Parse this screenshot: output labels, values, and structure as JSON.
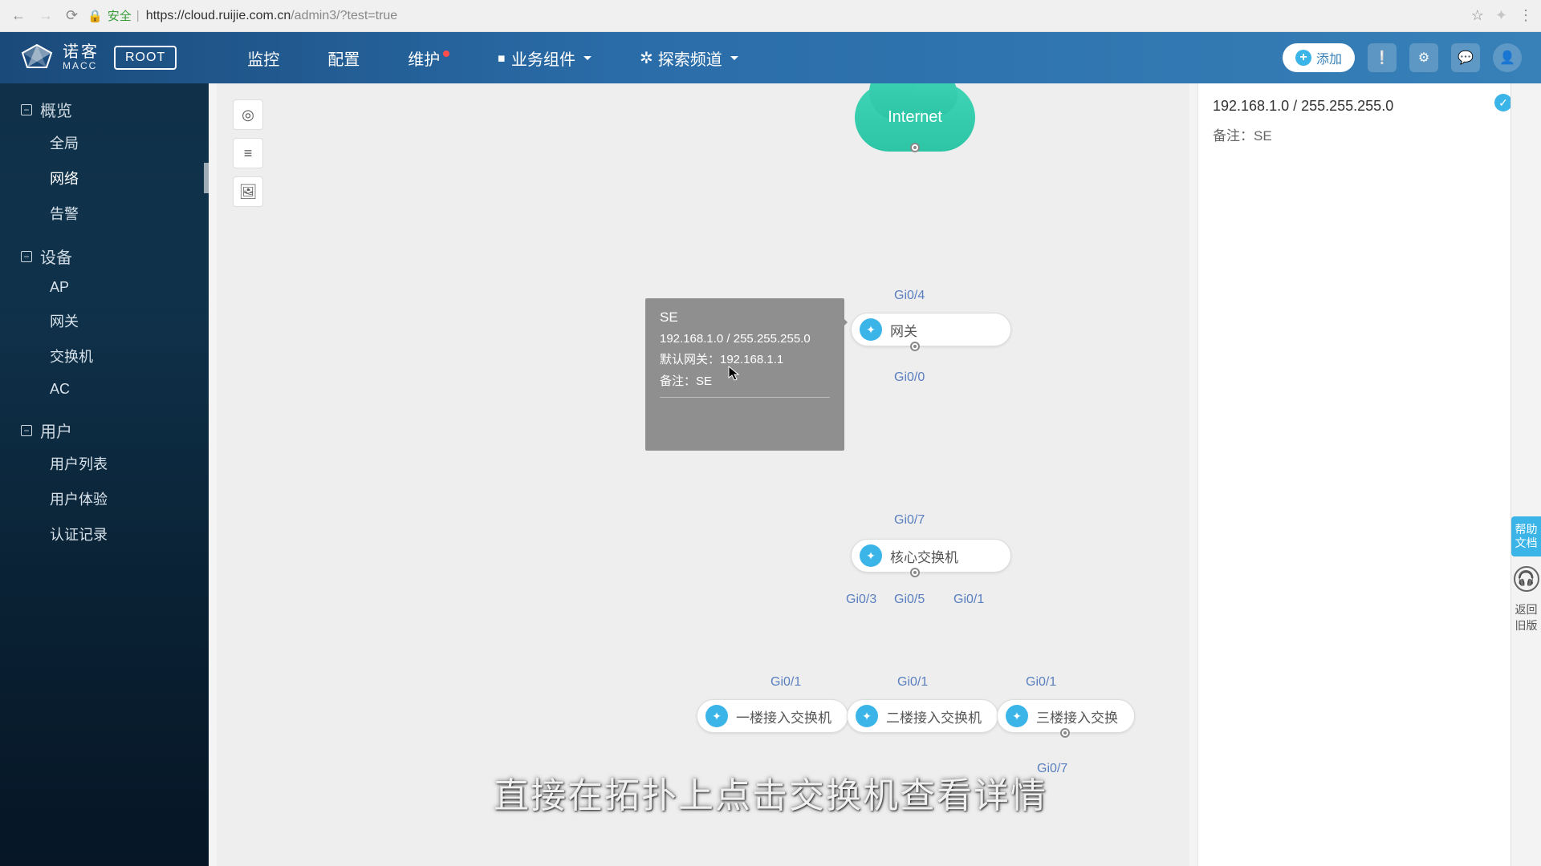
{
  "browser": {
    "secure_label": "安全",
    "url_host": "https://cloud.ruijie.com.cn",
    "url_path": "/admin3/?test=true"
  },
  "brand": {
    "cn": "诺客",
    "en": "MACC",
    "root": "ROOT"
  },
  "topnav": {
    "items": [
      "监控",
      "配置",
      "维护",
      "业务组件",
      "探索频道"
    ],
    "add": "添加"
  },
  "sidebar": {
    "groups": [
      {
        "title": "概览",
        "items": [
          "全局",
          "网络",
          "告警"
        ],
        "active": 1
      },
      {
        "title": "设备",
        "items": [
          "AP",
          "网关",
          "交换机",
          "AC"
        ]
      },
      {
        "title": "用户",
        "items": [
          "用户列表",
          "用户体验",
          "认证记录"
        ]
      }
    ]
  },
  "right_panel": {
    "ip": "192.168.1.0 / 255.255.255.0",
    "note": "备注：SE"
  },
  "topology": {
    "internet": "Internet",
    "nodes": {
      "gateway": "网关",
      "core": "核心交换机",
      "sw1": "一楼接入交换机",
      "sw2": "二楼接入交换机",
      "sw3": "三楼接入交换"
    },
    "ports": {
      "p4": "Gi0/4",
      "p0": "Gi0/0",
      "p7": "Gi0/7",
      "p3": "Gi0/3",
      "p5": "Gi0/5",
      "p1": "Gi0/1",
      "p7b": "Gi0/7"
    }
  },
  "tooltip": {
    "title": "SE",
    "ip": "192.168.1.0 / 255.255.255.0",
    "gw": "默认网关：192.168.1.1",
    "note": "备注：SE"
  },
  "subtitle": "直接在拓扑上点击交换机查看详情",
  "rail": {
    "help": "帮助\n文档",
    "back": "返回\n旧版"
  }
}
